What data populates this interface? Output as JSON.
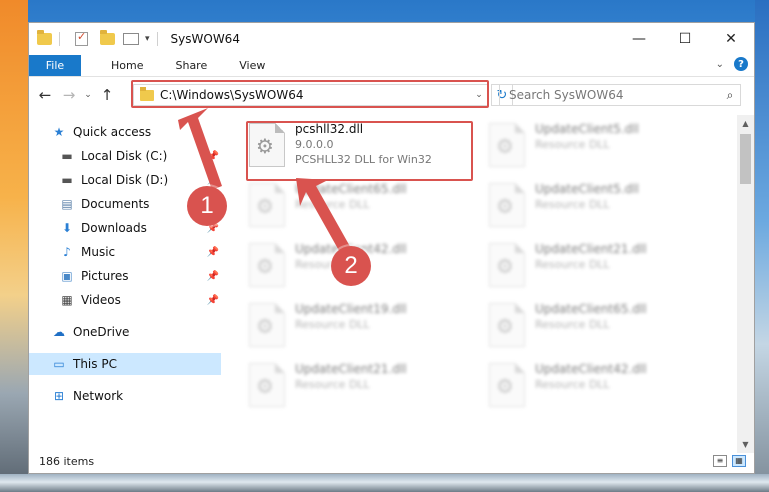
{
  "window": {
    "title": "SysWOW64",
    "controls": {
      "minimize": "—",
      "maximize": "☐",
      "close": "✕"
    }
  },
  "ribbon": {
    "tabs": [
      "File",
      "Home",
      "Share",
      "View"
    ],
    "help": "?"
  },
  "navigation": {
    "back": "←",
    "forward": "→",
    "recent": "⌄",
    "up": "↑",
    "address_path": "C:\\Windows\\SysWOW64",
    "refresh": "↻",
    "search_placeholder": "Search SysWOW64"
  },
  "sidebar": {
    "items": [
      {
        "label": "Quick access",
        "icon": "star-icon"
      },
      {
        "label": "Local Disk (C:)",
        "icon": "drive-icon"
      },
      {
        "label": "Local Disk (D:)",
        "icon": "drive-icon"
      },
      {
        "label": "Documents",
        "icon": "document-icon"
      },
      {
        "label": "Downloads",
        "icon": "download-icon"
      },
      {
        "label": "Music",
        "icon": "music-icon"
      },
      {
        "label": "Pictures",
        "icon": "picture-icon"
      },
      {
        "label": "Videos",
        "icon": "video-icon"
      },
      {
        "label": "OneDrive",
        "icon": "cloud-icon"
      },
      {
        "label": "This PC",
        "icon": "computer-icon"
      },
      {
        "label": "Network",
        "icon": "network-icon"
      }
    ]
  },
  "files": [
    {
      "name": "pcshll32.dll",
      "version": "9.0.0.0",
      "description": "PCSHLL32 DLL for Win32"
    },
    {
      "name": "UpdateClient5.dll",
      "description": "Resource DLL"
    },
    {
      "name": "UpdateClient65.dll",
      "description": "Resource DLL"
    },
    {
      "name": "UpdateClient5.dll",
      "description": "Resource DLL"
    },
    {
      "name": "UpdateClient42.dll",
      "description": "Resource DLL"
    },
    {
      "name": "UpdateClient21.dll",
      "description": "Resource DLL"
    },
    {
      "name": "UpdateClient19.dll",
      "description": "Resource DLL"
    },
    {
      "name": "UpdateClient65.dll",
      "description": "Resource DLL"
    },
    {
      "name": "UpdateClient21.dll",
      "description": "Resource DLL"
    },
    {
      "name": "UpdateClient42.dll",
      "description": "Resource DLL"
    }
  ],
  "status": {
    "item_count": "186 items"
  },
  "callouts": [
    "1",
    "2"
  ],
  "accent_color": "#1979ca",
  "highlight_color": "#d9534f"
}
